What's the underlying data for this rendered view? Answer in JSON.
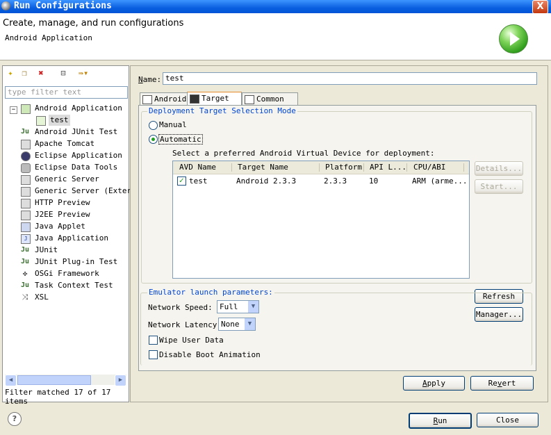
{
  "window": {
    "title": "Run Configurations",
    "close_glyph": "X"
  },
  "header": {
    "title": "Create, manage, and run configurations",
    "subtitle": "Android Application"
  },
  "left": {
    "toolbar": [
      "new-config-icon",
      "duplicate-icon",
      "delete-icon",
      "collapse-all-icon",
      "filter-icon"
    ],
    "filter_placeholder": "type filter text",
    "tree": [
      {
        "label": "Android Application",
        "level": 0,
        "expand": "−"
      },
      {
        "label": "test",
        "level": 1
      },
      {
        "label": "Android JUnit Test",
        "level": 0
      },
      {
        "label": "Apache Tomcat",
        "level": 0
      },
      {
        "label": "Eclipse Application",
        "level": 0
      },
      {
        "label": "Eclipse Data Tools",
        "level": 0
      },
      {
        "label": "Generic Server",
        "level": 0
      },
      {
        "label": "Generic Server (Externa",
        "level": 0
      },
      {
        "label": "HTTP Preview",
        "level": 0
      },
      {
        "label": "J2EE Preview",
        "level": 0
      },
      {
        "label": "Java Applet",
        "level": 0
      },
      {
        "label": "Java Application",
        "level": 0
      },
      {
        "label": "JUnit",
        "level": 0
      },
      {
        "label": "JUnit Plug-in Test",
        "level": 0
      },
      {
        "label": "OSGi Framework",
        "level": 0
      },
      {
        "label": "Task Context Test",
        "level": 0
      },
      {
        "label": "XSL",
        "level": 0
      }
    ],
    "filter_status": "Filter matched 17 of 17 items"
  },
  "right": {
    "name_label": "Name:",
    "name_value": "test",
    "tabs": [
      "Android",
      "Target",
      "Common"
    ],
    "deploy_group": "Deployment Target Selection Mode",
    "manual_label": "Manual",
    "automatic_label": "Automatic",
    "select_avd_text": "Select a preferred Android Virtual Device for deployment:",
    "columns": [
      "AVD Name",
      "Target Name",
      "Platform",
      "API L...",
      "CPU/ABI"
    ],
    "rows": [
      {
        "name": "test",
        "target": "Android 2.3.3",
        "platform": "2.3.3",
        "api": "10",
        "cpu": "ARM (arme..."
      }
    ],
    "details_btn": "Details...",
    "start_btn": "Start...",
    "refresh_btn": "Refresh",
    "manager_btn": "Manager...",
    "emulator_group": "Emulator launch parameters:",
    "net_speed_label": "Network Speed:",
    "net_speed_value": "Full",
    "net_latency_label": "Network Latency:",
    "net_latency_value": "None",
    "wipe_label": "Wipe User Data",
    "disable_boot_label": "Disable Boot Animation",
    "apply_btn": "Apply",
    "revert_btn": "Revert"
  },
  "footer": {
    "run_btn": "Run",
    "close_btn": "Close",
    "help_glyph": "?"
  }
}
